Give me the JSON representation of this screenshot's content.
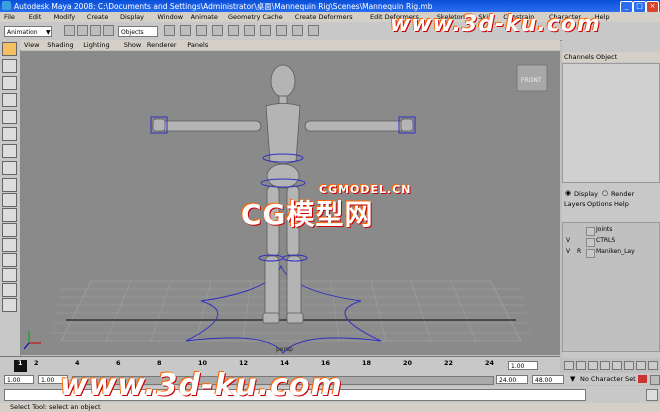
{
  "window": {
    "title": "Autodesk Maya 2008: C:\\Documents and Settings\\Administrator\\桌面\\Mannequin Rig\\Scenes\\Mannequin Rig.mb",
    "min": "_",
    "max": "□",
    "close": "×"
  },
  "menu": [
    "File",
    "Edit",
    "Modify",
    "Create",
    "Display",
    "Window",
    "Animate",
    "Geometry Cache",
    "Create Deformers",
    "Edit Deformers",
    "Skeleton",
    "Skin",
    "Constrain",
    "Character",
    "Help"
  ],
  "statusline": {
    "mode": "Animation",
    "objects_label": "Objects"
  },
  "panel_menu": [
    "View",
    "Shading",
    "Lighting",
    "Show",
    "Renderer",
    "Panels"
  ],
  "viewport": {
    "cube_label": "FRONT",
    "camera_label": "persp"
  },
  "channelbox": {
    "menu": [
      "Channels",
      "Object"
    ],
    "display_tabs": [
      "Display",
      "Render"
    ],
    "layer_menu": [
      "Layers",
      "Options",
      "Help"
    ],
    "layers": [
      {
        "v": "",
        "r": "",
        "name": "Joints"
      },
      {
        "v": "V",
        "r": "",
        "name": "CTRLS"
      },
      {
        "v": "V",
        "r": "R",
        "name": "Maniken_Lay"
      }
    ]
  },
  "timeslider": {
    "ticks": [
      "1",
      "2",
      "4",
      "6",
      "8",
      "10",
      "12",
      "14",
      "16",
      "18",
      "20",
      "22",
      "24"
    ],
    "current": "1.00"
  },
  "rangeslider": {
    "start": "1.00",
    "inner_start": "1.00",
    "inner_end": "24.00",
    "end": "48.00",
    "character": "No Character Set"
  },
  "helpline": "Select Tool: select an object",
  "watermarks": {
    "top": "www.3d-ku.com",
    "center_small": "CGMODEL.CN",
    "center_big": "CG模型网",
    "bottom": "www.3d-ku.com"
  },
  "colors": {
    "title_bg": "#0a4fd8",
    "viewport_bg": "#8a8a8a",
    "grid": "#9a9a9a"
  }
}
